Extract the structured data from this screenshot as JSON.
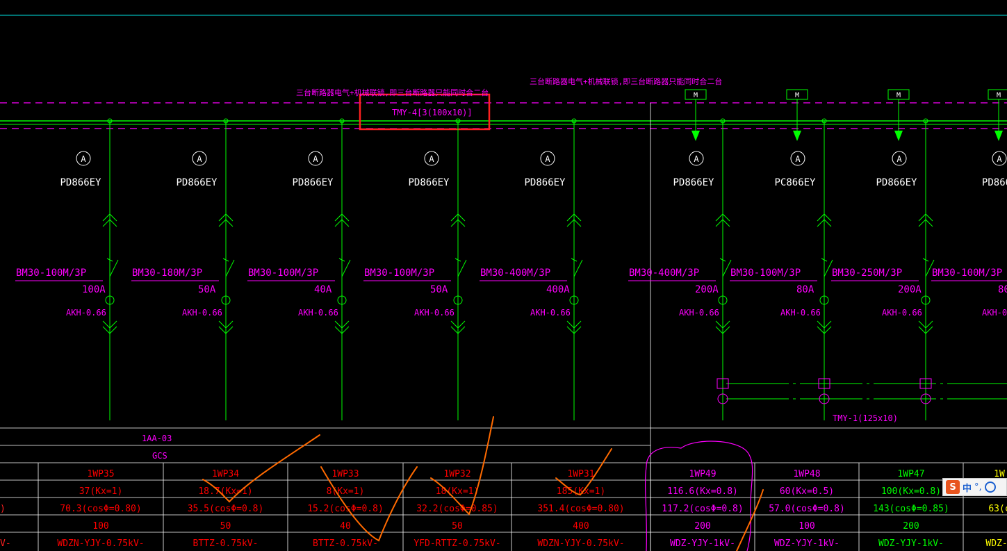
{
  "colors": {
    "green": "#00ff00",
    "magenta": "#ff00ff",
    "white": "#ffffff",
    "red": "#ff0000",
    "cyan": "#00ffff",
    "orange": "#ff6a00"
  },
  "annotations": {
    "note_left": "三台断路器电气+机械联锁,即三台断路器只能同时合二台",
    "note_right": "三台断路器电气+机械联锁,即三台断路器只能同时合二台",
    "busbar_main": "TMY-4[3(100x10)]",
    "busbar_secondary": "TMY-1(125x10)",
    "motor_label": "M",
    "ammeter_symbol": "A"
  },
  "feeders": [
    {
      "meter": "PD866EY",
      "breaker": "BM30-100M/3P",
      "rating": "100A",
      "ct": "AKH-0.66"
    },
    {
      "meter": "PD866EY",
      "breaker": "BM30-180M/3P",
      "rating": "50A",
      "ct": "AKH-0.66"
    },
    {
      "meter": "PD866EY",
      "breaker": "BM30-100M/3P",
      "rating": "40A",
      "ct": "AKH-0.66"
    },
    {
      "meter": "PD866EY",
      "breaker": "BM30-100M/3P",
      "rating": "50A",
      "ct": "AKH-0.66"
    },
    {
      "meter": "PD866EY",
      "breaker": "BM30-400M/3P",
      "rating": "400A",
      "ct": "AKH-0.66"
    },
    {
      "meter": "PD866EY",
      "breaker": "BM30-400M/3P",
      "rating": "200A",
      "ct": "AKH-0.66"
    },
    {
      "meter": "PC866EY",
      "breaker": "BM30-100M/3P",
      "rating": "80A",
      "ct": "AKH-0.66"
    },
    {
      "meter": "PD866EY",
      "breaker": "BM30-250M/3P",
      "rating": "200A",
      "ct": "AKH-0.66"
    },
    {
      "meter": "PD866",
      "breaker": "BM30-100M/3P",
      "rating": "80A",
      "ct": "AKH-0"
    }
  ],
  "table": {
    "cabinet_no": "1AA-03",
    "cabinet_type": "GCS",
    "columns": [
      {
        "circuit": "1WP35",
        "power": "37(Kx=1)",
        "current": "70.3(cosΦ=0.80)",
        "breaker": "100",
        "cable": "WDZN-YJY-0.75kV-"
      },
      {
        "circuit": "1WP34",
        "power": "18.7(Kx=1)",
        "current": "35.5(cosΦ=0.8)",
        "breaker": "50",
        "cable": "BTTZ-0.75kV-"
      },
      {
        "circuit": "1WP33",
        "power": "8(Kx=1)",
        "current": "15.2(cosΦ=0.8)",
        "breaker": "40",
        "cable": "BTTZ-0.75kV-"
      },
      {
        "circuit": "1WP32",
        "power": "18(Kx=1)",
        "current": "32.2(cosΦ=0.85)",
        "breaker": "50",
        "cable": "YFD-RTTZ-0.75kV-"
      },
      {
        "circuit": "1WP31",
        "power": "185(Kx=1)",
        "current": "351.4(cosΦ=0.80)",
        "breaker": "400",
        "cable": "WDZN-YJY-0.75kV-"
      },
      {
        "circuit": "1WP49",
        "power": "116.6(Kx=0.8)",
        "current": "117.2(cosΦ=0.8)",
        "breaker": "200",
        "cable": "WDZ-YJY-1kV-"
      },
      {
        "circuit": "1WP48",
        "power": "60(Kx=0.5)",
        "current": "57.0(cosΦ=0.8)",
        "breaker": "100",
        "cable": "WDZ-YJY-1kV-"
      },
      {
        "circuit": "1WP47",
        "power": "100(Kx=0.8)",
        "current": "143(cosΦ=0.85)",
        "breaker": "200",
        "cable": "WDZ-YJY-1kV-"
      },
      {
        "circuit": "1W",
        "power": "",
        "current": "63(c",
        "breaker": "",
        "cable": "WDZ-Y"
      }
    ],
    "left_partial_current": ")",
    "left_partial_cable": "V-"
  },
  "ime": {
    "logo": "S",
    "lang": "中",
    "punct": "°,"
  }
}
